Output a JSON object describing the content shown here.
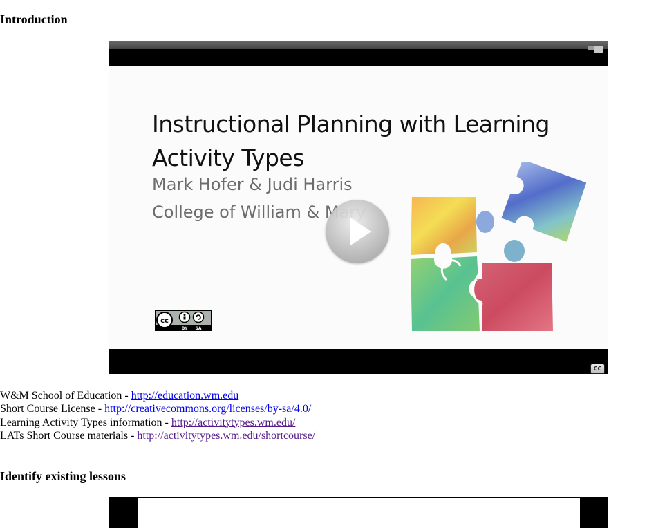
{
  "sections": {
    "intro_heading": "Introduction",
    "identify_heading": "Identify existing lessons"
  },
  "video1": {
    "slide": {
      "title_line1": "Instructional Planning with Learning",
      "title_line2": "Activity Types",
      "author": "Mark Hofer & Judi Harris",
      "college": "College of William & Mary"
    },
    "license_badge": {
      "left_text": "BY",
      "right_text": "SA",
      "icon": "creative-commons-by-sa-icon"
    },
    "cc_label": "CC",
    "play_icon": "play-icon"
  },
  "links": [
    {
      "label": "W&M School of Education - ",
      "url": "http://education.wm.edu"
    },
    {
      "label": "Short Course License - ",
      "url": "http://creativecommons.org/licenses/by-sa/4.0/"
    },
    {
      "label": "Learning Activity Types information - ",
      "url": "http://activitytypes.wm.edu/"
    },
    {
      "label": "LATs Short Course materials - ",
      "url": "http://activitytypes.wm.edu/shortcourse/"
    }
  ],
  "colors": {
    "link_unvisited": "#0000ee",
    "link_visited": "#551a8b",
    "slide_title": "#111111",
    "slide_subtitle": "#6c6c6c"
  }
}
